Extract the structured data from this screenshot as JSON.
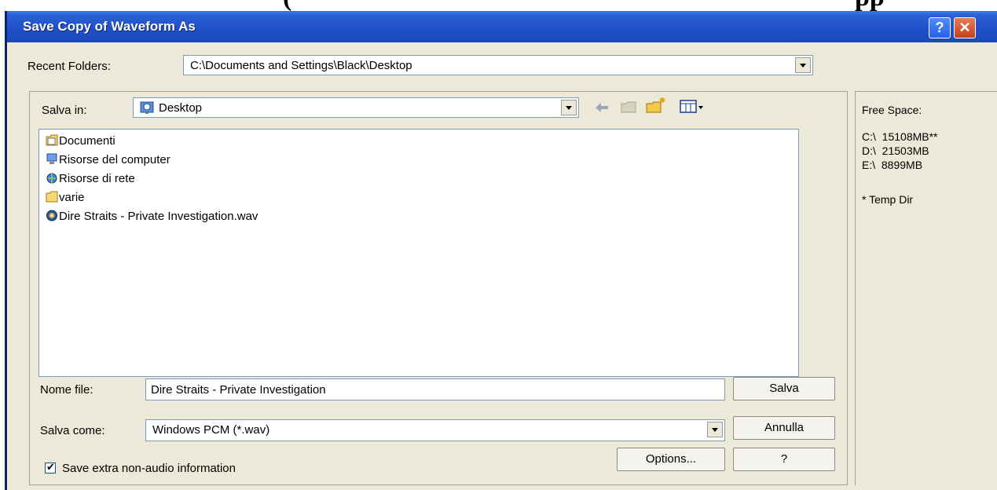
{
  "window": {
    "title": "Save Copy of Waveform As"
  },
  "titlebar": {
    "help_label": "?",
    "close_label": "✕"
  },
  "recent_folders": {
    "label": "Recent Folders:",
    "value": "C:\\Documents and Settings\\Black\\Desktop"
  },
  "save_in": {
    "label": "Salva in:",
    "value": "Desktop"
  },
  "files": [
    {
      "name": "Documenti",
      "icon": "documents-folder-icon"
    },
    {
      "name": "Risorse del computer",
      "icon": "my-computer-icon"
    },
    {
      "name": "Risorse di rete",
      "icon": "network-places-icon"
    },
    {
      "name": "varie",
      "icon": "folder-icon"
    },
    {
      "name": "Dire Straits - Private Investigation.wav",
      "icon": "wav-file-icon"
    }
  ],
  "filename": {
    "label": "Nome file:",
    "value": "Dire Straits - Private Investigation"
  },
  "filetype": {
    "label": "Salva come:",
    "value": "Windows PCM (*.wav)"
  },
  "buttons": {
    "save": "Salva",
    "cancel": "Annulla",
    "options": "Options...",
    "help": "?"
  },
  "checkbox": {
    "label": "Save extra non-audio information",
    "checked": true
  },
  "free_space": {
    "title": "Free Space:",
    "drives": [
      "C:\\  15108MB**",
      "D:\\  21503MB",
      "E:\\  8899MB"
    ],
    "note": "* Temp Dir"
  },
  "colors": {
    "titlebar": "#1f4fc9",
    "dialog_bg": "#ece9d8",
    "close": "#c2401c"
  }
}
